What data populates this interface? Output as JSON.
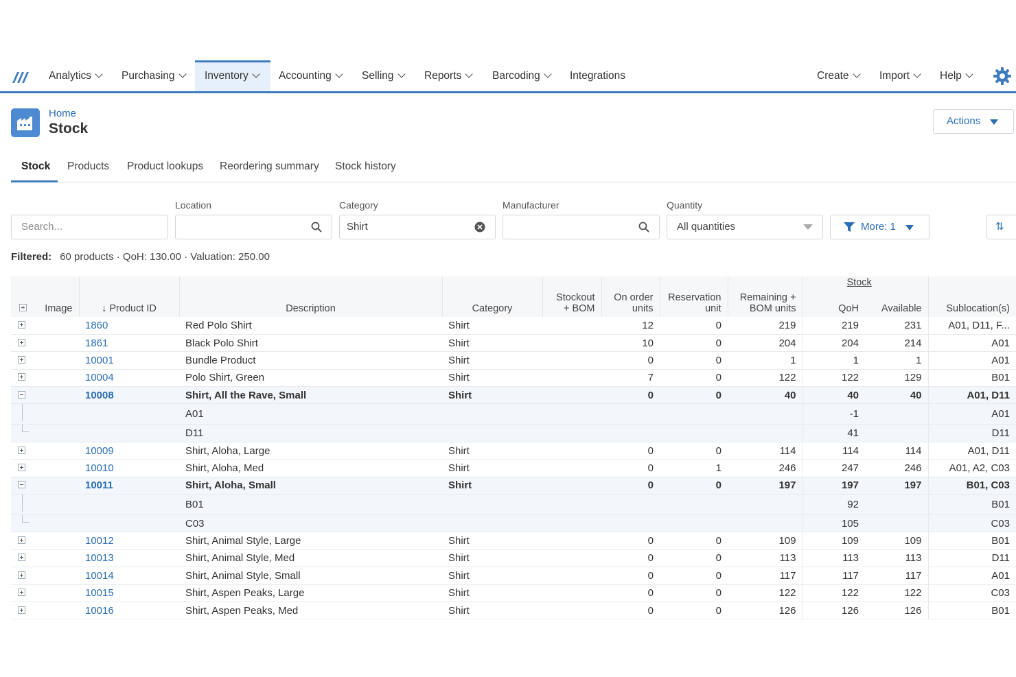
{
  "nav": {
    "items": [
      "Analytics",
      "Purchasing",
      "Inventory",
      "Accounting",
      "Selling",
      "Reports",
      "Barcoding",
      "Integrations"
    ],
    "right": [
      "Create",
      "Import",
      "Help"
    ],
    "active": "Inventory",
    "accent": "#3f7bbf"
  },
  "header": {
    "breadcrumb": "Home",
    "title": "Stock",
    "actions_label": "Actions"
  },
  "tabs": [
    "Stock",
    "Products",
    "Product lookups",
    "Reordering summary",
    "Stock history"
  ],
  "filters": {
    "search_placeholder": "Search...",
    "location_label": "Location",
    "location_value": "",
    "category_label": "Category",
    "category_value": "Shirt",
    "manufacturer_label": "Manufacturer",
    "manufacturer_value": "",
    "quantity_label": "Quantity",
    "quantity_value": "All quantities",
    "more_label": "More: 1",
    "sort_label": "⇅"
  },
  "summary": {
    "label": "Filtered:",
    "text": "60 products · QoH: 130.00 · Valuation: 250.00"
  },
  "table": {
    "group_header": "Stock",
    "headers": {
      "image": "Image",
      "product_id": "↓ Product ID",
      "description": "Description",
      "category": "Category",
      "stockout_line1": "Stockout",
      "stockout_line2": "+ BOM",
      "on_order_line1": "On order",
      "on_order_line2": "units",
      "reservation_line1": "Reservation",
      "reservation_line2": "unit",
      "remaining_line1": "Remaining +",
      "remaining_line2": "BOM units",
      "qoh": "QoH",
      "available": "Available",
      "sublocations": "Sublocation(s)"
    },
    "rows": [
      {
        "type": "row",
        "id": "1860",
        "desc": "Red Polo Shirt",
        "cat": "Shirt",
        "stockout": "",
        "onorder": "12",
        "reserv": "0",
        "remain": "219",
        "qoh": "219",
        "avail": "231",
        "subloc": "A01, D11, F..."
      },
      {
        "type": "row",
        "id": "1861",
        "desc": "Black Polo Shirt",
        "cat": "Shirt",
        "stockout": "",
        "onorder": "10",
        "reserv": "0",
        "remain": "204",
        "qoh": "204",
        "avail": "214",
        "subloc": "A01"
      },
      {
        "type": "row",
        "id": "10001",
        "desc": "Bundle Product",
        "cat": "Shirt",
        "stockout": "",
        "onorder": "0",
        "reserv": "0",
        "remain": "1",
        "qoh": "1",
        "avail": "1",
        "subloc": "A01"
      },
      {
        "type": "row",
        "id": "10004",
        "desc": "Polo Shirt, Green",
        "cat": "Shirt",
        "stockout": "",
        "onorder": "7",
        "reserv": "0",
        "remain": "122",
        "qoh": "122",
        "avail": "129",
        "subloc": "B01"
      },
      {
        "type": "expanded",
        "id": "10008",
        "desc": "Shirt, All the Rave, Small",
        "cat": "Shirt",
        "stockout": "",
        "onorder": "0",
        "reserv": "0",
        "remain": "40",
        "qoh": "40",
        "avail": "40",
        "subloc": "A01, D11"
      },
      {
        "type": "sub",
        "desc": "A01",
        "qoh": "-1",
        "subloc": "A01",
        "last": false
      },
      {
        "type": "sub",
        "desc": "D11",
        "qoh": "41",
        "subloc": "D11",
        "last": true
      },
      {
        "type": "row",
        "id": "10009",
        "desc": "Shirt, Aloha, Large",
        "cat": "Shirt",
        "stockout": "",
        "onorder": "0",
        "reserv": "0",
        "remain": "114",
        "qoh": "114",
        "avail": "114",
        "subloc": "A01, D11"
      },
      {
        "type": "row",
        "id": "10010",
        "desc": "Shirt, Aloha, Med",
        "cat": "Shirt",
        "stockout": "",
        "onorder": "0",
        "reserv": "1",
        "remain": "246",
        "qoh": "247",
        "avail": "246",
        "subloc": "A01, A2, C03"
      },
      {
        "type": "expanded",
        "id": "10011",
        "desc": "Shirt, Aloha, Small",
        "cat": "Shirt",
        "stockout": "",
        "onorder": "0",
        "reserv": "0",
        "remain": "197",
        "qoh": "197",
        "avail": "197",
        "subloc": "B01, C03"
      },
      {
        "type": "sub",
        "desc": "B01",
        "qoh": "92",
        "subloc": "B01",
        "last": false
      },
      {
        "type": "sub",
        "desc": "C03",
        "qoh": "105",
        "subloc": "C03",
        "last": true
      },
      {
        "type": "row",
        "id": "10012",
        "desc": "Shirt, Animal Style, Large",
        "cat": "Shirt",
        "stockout": "",
        "onorder": "0",
        "reserv": "0",
        "remain": "109",
        "qoh": "109",
        "avail": "109",
        "subloc": "B01"
      },
      {
        "type": "row",
        "id": "10013",
        "desc": "Shirt, Animal Style, Med",
        "cat": "Shirt",
        "stockout": "",
        "onorder": "0",
        "reserv": "0",
        "remain": "113",
        "qoh": "113",
        "avail": "113",
        "subloc": "D11"
      },
      {
        "type": "row",
        "id": "10014",
        "desc": "Shirt, Animal Style, Small",
        "cat": "Shirt",
        "stockout": "",
        "onorder": "0",
        "reserv": "0",
        "remain": "117",
        "qoh": "117",
        "avail": "117",
        "subloc": "A01"
      },
      {
        "type": "row",
        "id": "10015",
        "desc": "Shirt, Aspen Peaks, Large",
        "cat": "Shirt",
        "stockout": "",
        "onorder": "0",
        "reserv": "0",
        "remain": "122",
        "qoh": "122",
        "avail": "122",
        "subloc": "C03"
      },
      {
        "type": "row",
        "id": "10016",
        "desc": "Shirt, Aspen Peaks, Med",
        "cat": "Shirt",
        "stockout": "",
        "onorder": "0",
        "reserv": "0",
        "remain": "126",
        "qoh": "126",
        "avail": "126",
        "subloc": "B01"
      }
    ]
  }
}
